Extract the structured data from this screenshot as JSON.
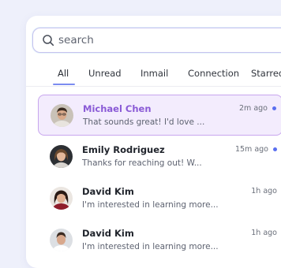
{
  "search": {
    "placeholder": "search",
    "value": ""
  },
  "tabs": [
    {
      "label": "All",
      "active": true
    },
    {
      "label": "Unread",
      "active": false
    },
    {
      "label": "Inmail",
      "active": false
    },
    {
      "label": "Connection",
      "active": false
    },
    {
      "label": "Starred",
      "active": false
    }
  ],
  "conversations": [
    {
      "name": "Michael Chen",
      "preview": "That sounds great! I'd love ...",
      "time": "2m ago",
      "unread": true,
      "selected": true
    },
    {
      "name": "Emily Rodriguez",
      "preview": "Thanks for reaching out! W...",
      "time": "15m ago",
      "unread": true,
      "selected": false
    },
    {
      "name": "David Kim",
      "preview": "I'm interested in learning more...",
      "time": "1h ago",
      "unread": false,
      "selected": false
    },
    {
      "name": "David Kim",
      "preview": "I'm interested in learning more...",
      "time": "1h ago",
      "unread": false,
      "selected": false
    }
  ],
  "colors": {
    "accent": "#8a5ad6",
    "unread_dot": "#5a6ff0",
    "tab_underline": "#7b8cf0",
    "selected_bg": "#f3ecfd",
    "selected_border": "#c8a6ee"
  }
}
